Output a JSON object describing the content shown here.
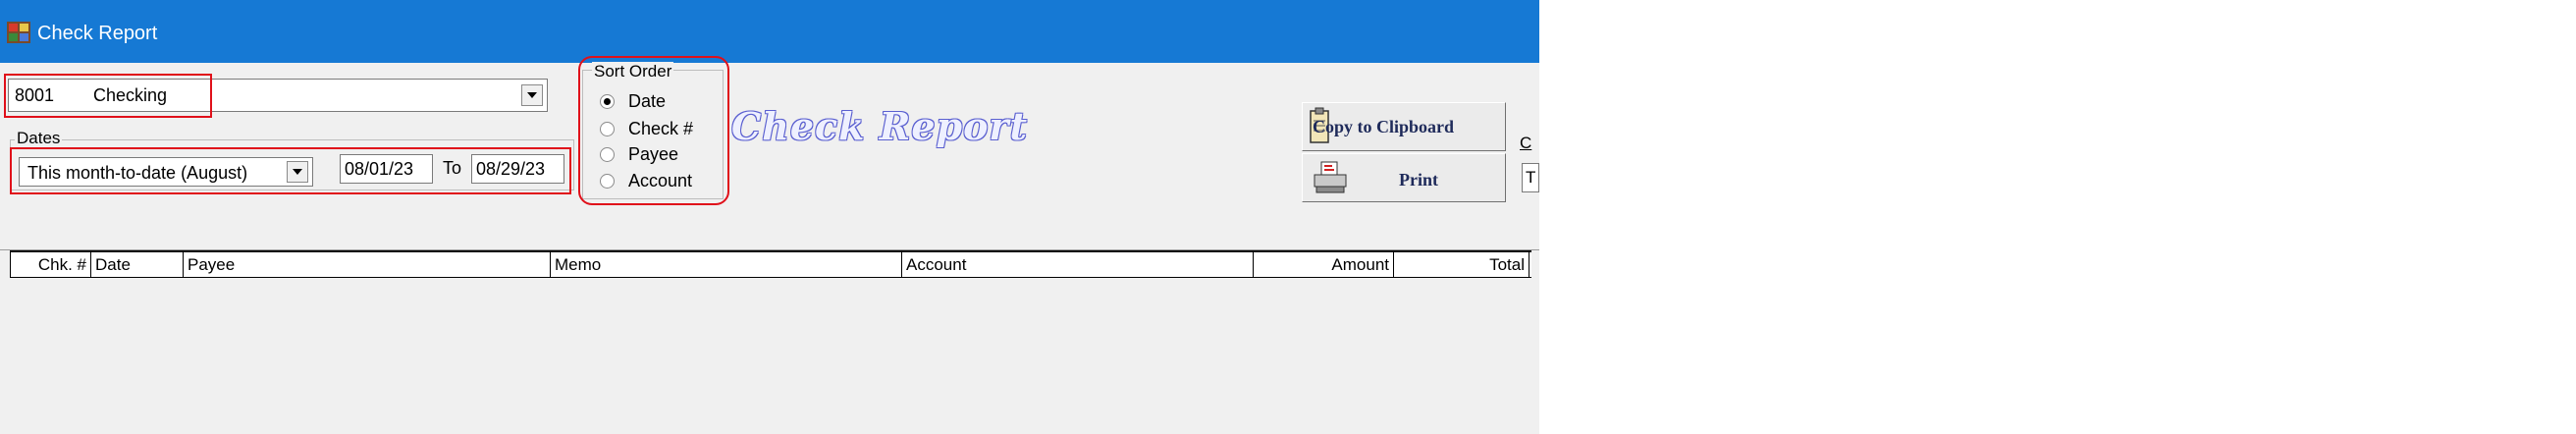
{
  "window": {
    "title": "Check Report"
  },
  "account_select": {
    "number": "8001",
    "name": "Checking"
  },
  "dates": {
    "group_label": "Dates",
    "range": "This month-to-date (August)",
    "from": "08/01/23",
    "to_label": "To",
    "to": "08/29/23"
  },
  "sort_order": {
    "label": "Sort Order",
    "options": [
      {
        "label": "Date",
        "selected": true
      },
      {
        "label": "Check #",
        "selected": false
      },
      {
        "label": "Payee",
        "selected": false
      },
      {
        "label": "Account",
        "selected": false
      }
    ]
  },
  "report_title": "Check Report",
  "buttons": {
    "copy": "Copy to Clipboard",
    "print": "Print"
  },
  "edge_text": {
    "top": "C",
    "bottom": "T"
  },
  "columns": [
    "Chk. #",
    "Date",
    "Payee",
    "Memo",
    "Account",
    "Amount",
    "Total"
  ],
  "colors": {
    "titlebar": "#1679d4",
    "highlight": "#e0101a",
    "report_title_outline": "#5a5fd0"
  }
}
